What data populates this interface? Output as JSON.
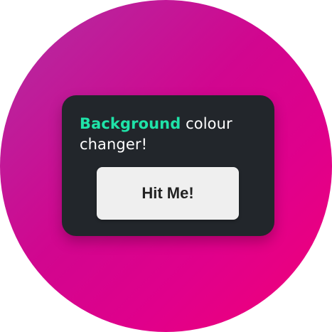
{
  "card": {
    "heading_accent": "Background",
    "heading_rest": " colour changer!",
    "button_label": "Hit Me!"
  },
  "colors": {
    "background_gradient": [
      "#b02fa2",
      "#d1068f",
      "#e0008b",
      "#f20078"
    ],
    "card_bg": "#22262b",
    "accent_text": "#1fe3a8",
    "heading_text": "#ffffff",
    "button_bg": "#efefef",
    "button_text": "#222222"
  }
}
